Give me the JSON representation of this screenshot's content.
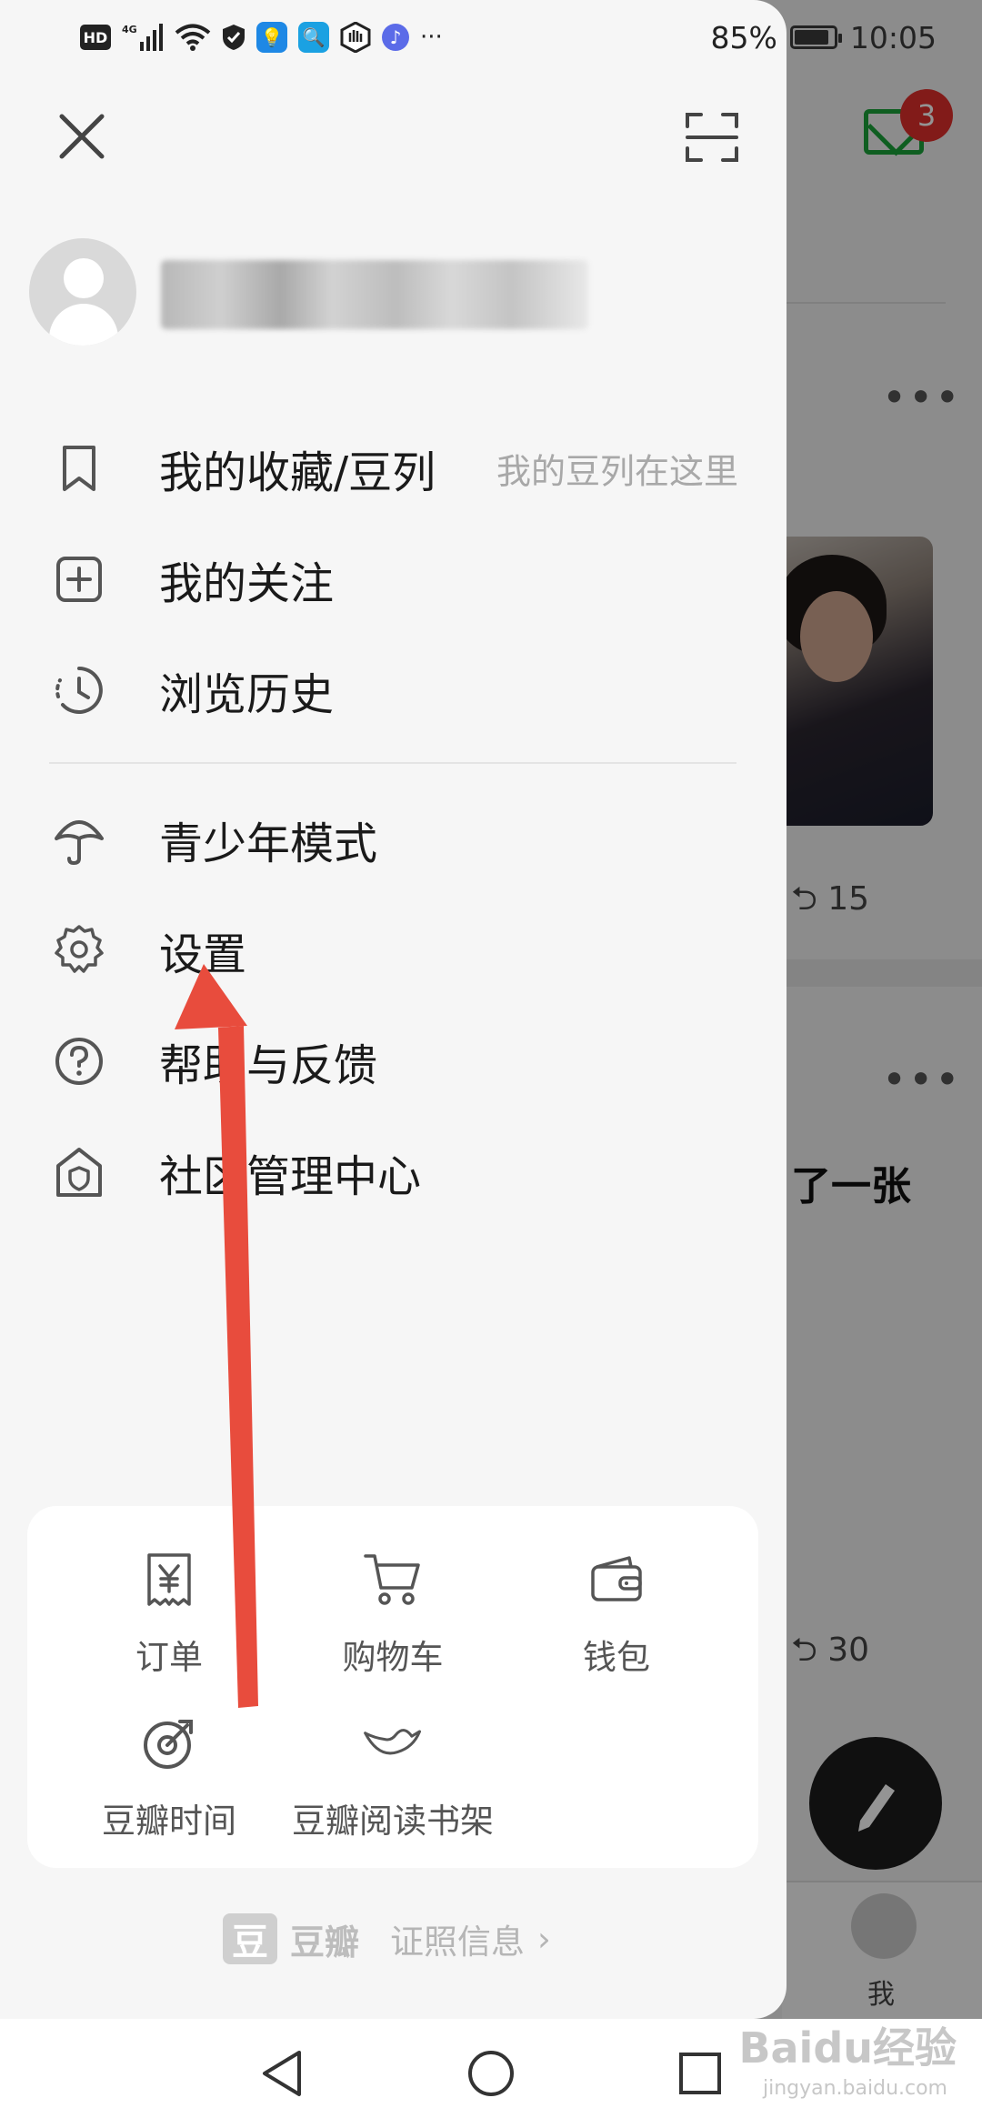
{
  "status_bar": {
    "network": "4G",
    "battery": "85%",
    "time": "10:05",
    "more": "···"
  },
  "background_app": {
    "message_badge": "3",
    "repost_count_1": "15",
    "repost_count_2": "30",
    "post_snippet": "了一张",
    "tab_me": "我"
  },
  "drawer": {
    "menu_group_1": [
      {
        "label": "我的收藏/豆列",
        "hint": "我的豆列在这里",
        "icon": "bookmark-icon"
      },
      {
        "label": "我的关注",
        "icon": "plus-square-icon"
      },
      {
        "label": "浏览历史",
        "icon": "history-clock-icon"
      }
    ],
    "menu_group_2": [
      {
        "label": "青少年模式",
        "icon": "umbrella-icon"
      },
      {
        "label": "设置",
        "icon": "gear-icon"
      },
      {
        "label": "帮助与反馈",
        "icon": "question-circle-icon"
      },
      {
        "label": "社区管理中心",
        "icon": "house-shield-icon"
      }
    ],
    "services": [
      {
        "label": "订单",
        "icon": "yen-receipt-icon"
      },
      {
        "label": "购物车",
        "icon": "shopping-cart-icon"
      },
      {
        "label": "钱包",
        "icon": "wallet-icon"
      },
      {
        "label": "豆瓣时间",
        "icon": "douban-time-icon"
      },
      {
        "label": "豆瓣阅读书架",
        "icon": "bird-icon"
      }
    ],
    "footer": {
      "logo_char": "豆",
      "brand": "豆瓣",
      "license": "证照信息",
      "chevron": "›"
    }
  },
  "watermark": {
    "main": "Baidu经验",
    "sub": "jingyan.baidu.com"
  },
  "colors": {
    "annotation_arrow": "#e84c3d",
    "accent_green": "#1aa33a",
    "badge_red": "#e0302c"
  }
}
